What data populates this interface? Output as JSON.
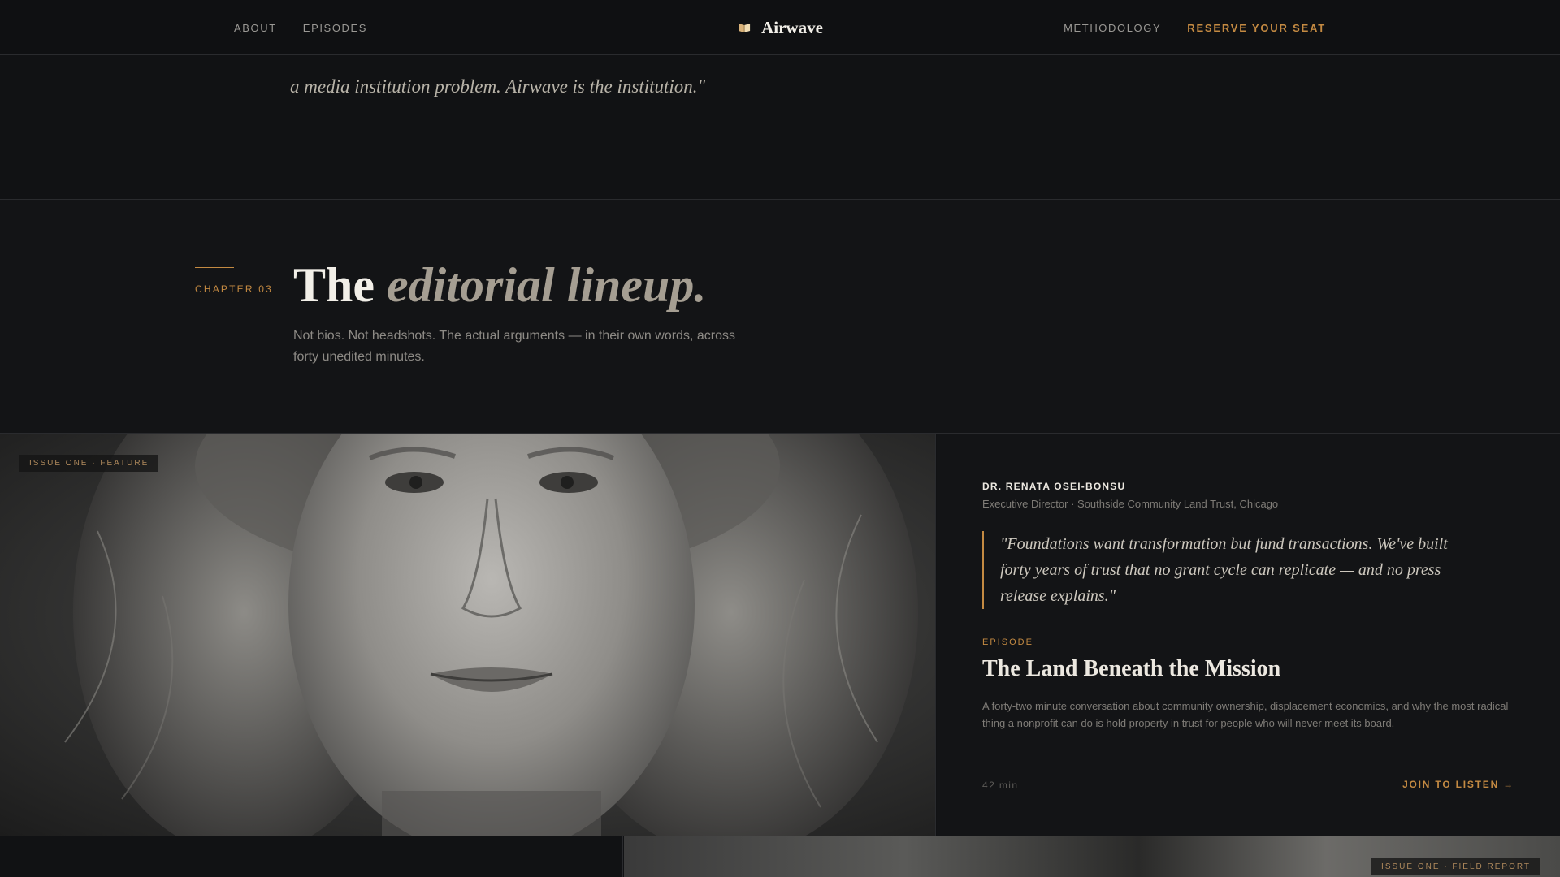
{
  "nav": {
    "left_links": [
      "ABOUT",
      "EPISODES"
    ],
    "brand": {
      "name": "Airwave",
      "icon": "book-icon"
    },
    "right_link": "METHODOLOGY",
    "cta": "RESERVE YOUR SEAT"
  },
  "intro_quote": {
    "line_partial": "... ... ... ... ...",
    "line_full": "a media institution problem. Airwave is the institution.\""
  },
  "chapter": {
    "kicker": "CHAPTER 03",
    "title_plain": "The ",
    "title_italic": "editorial lineup.",
    "subtitle": "Not bios. Not headshots. The actual arguments — in their own words, across forty unedited minutes."
  },
  "feature": {
    "tag": "ISSUE ONE · FEATURE",
    "guest_name": "DR. RENATA OSEI-BONSU",
    "guest_role": "Executive Director · Southside Community Land Trust, Chicago",
    "quote": "\"Foundations want transformation but fund transactions. We've built forty years of trust that no grant cycle can replicate — and no press release explains.\"",
    "episode_kicker": "EPISODE",
    "episode_title": "The Land Beneath the Mission",
    "episode_desc": "A forty-two minute conversation about community ownership, displacement economics, and why the most radical thing a nonprofit can do is hold property in trust for people who will never meet its board.",
    "duration": "42 min",
    "cta": "JOIN TO LISTEN →"
  },
  "next": {
    "tag": "ISSUE ONE · FIELD REPORT"
  },
  "colors": {
    "accent": "#c48a42",
    "background": "#111214",
    "text": "#ece8e0"
  }
}
